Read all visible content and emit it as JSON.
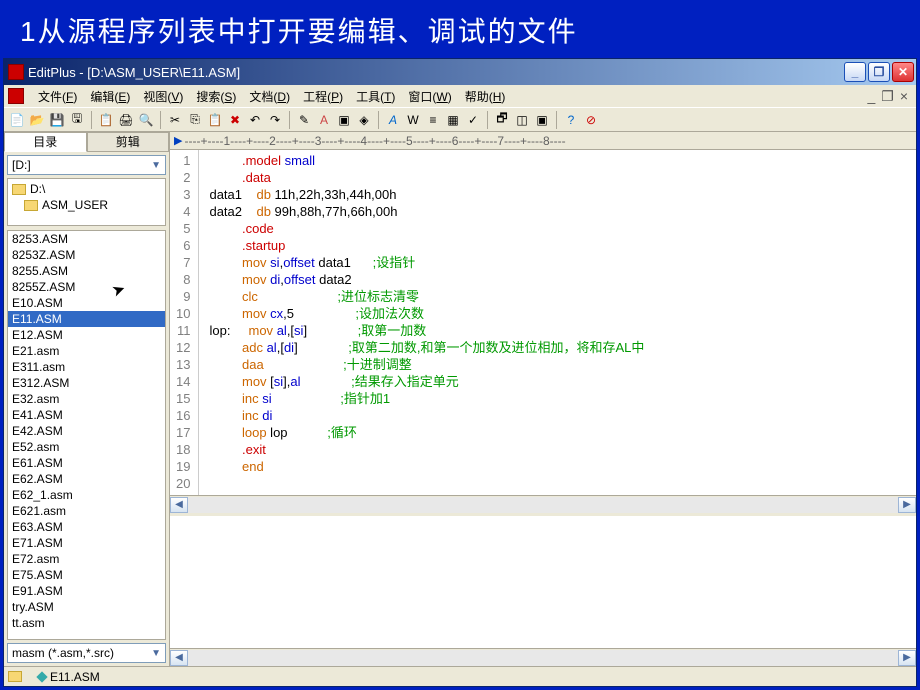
{
  "slide": {
    "title": "1从源程序列表中打开要编辑、调试的文件"
  },
  "titlebar": {
    "text": "EditPlus - [D:\\ASM_USER\\E11.ASM]"
  },
  "menu": {
    "items": [
      {
        "label": "文件",
        "accel": "F"
      },
      {
        "label": "编辑",
        "accel": "E"
      },
      {
        "label": "视图",
        "accel": "V"
      },
      {
        "label": "搜索",
        "accel": "S"
      },
      {
        "label": "文档",
        "accel": "D"
      },
      {
        "label": "工程",
        "accel": "P"
      },
      {
        "label": "工具",
        "accel": "T"
      },
      {
        "label": "窗口",
        "accel": "W"
      },
      {
        "label": "帮助",
        "accel": "H"
      }
    ]
  },
  "sidebar": {
    "tabs": {
      "dir": "目录",
      "clip": "剪辑"
    },
    "drive": "[D:]",
    "dirs": [
      "D:\\",
      "ASM_USER"
    ],
    "files": [
      "8253.ASM",
      "8253Z.ASM",
      "8255.ASM",
      "8255Z.ASM",
      "E10.ASM",
      "E11.ASM",
      "E12.ASM",
      "E21.asm",
      "E311.asm",
      "E312.ASM",
      "E32.asm",
      "E41.ASM",
      "E42.ASM",
      "E52.asm",
      "E61.ASM",
      "E62.ASM",
      "E62_1.asm",
      "E621.asm",
      "E63.ASM",
      "E71.ASM",
      "E72.asm",
      "E75.ASM",
      "E91.ASM",
      "try.ASM",
      "tt.asm"
    ],
    "selected_file": "E11.ASM",
    "filter": "masm (*.asm,*.src)"
  },
  "ruler": "----+----1----+----2----+----3----+----4----+----5----+----6----+----7----+----8----",
  "code_lines": [
    {
      "n": 1,
      "html": "         <span class='dir'>.model</span> <span class='kw'>small</span>"
    },
    {
      "n": 2,
      "html": "         <span class='dir'>.data</span>"
    },
    {
      "n": 3,
      "html": "<span class='lbl'>data1</span>    <span class='inst'>db</span> 11h,22h,33h,44h,00h"
    },
    {
      "n": 4,
      "html": "<span class='lbl'>data2</span>    <span class='inst'>db</span> 99h,88h,77h,66h,00h"
    },
    {
      "n": 5,
      "html": "         <span class='dir'>.code</span>"
    },
    {
      "n": 6,
      "html": "         <span class='dir'>.startup</span>"
    },
    {
      "n": 7,
      "html": "         <span class='inst'>mov</span> <span class='kw'>si</span>,<span class='kw'>offset</span> data1      <span class='cmt'>;设指针</span>"
    },
    {
      "n": 8,
      "html": "         <span class='inst'>mov</span> <span class='kw'>di</span>,<span class='kw'>offset</span> data2"
    },
    {
      "n": 9,
      "html": "         <span class='inst'>clc</span>                      <span class='cmt'>;进位标志清零</span>"
    },
    {
      "n": 10,
      "html": "         <span class='inst'>mov</span> <span class='kw'>cx</span>,5                 <span class='cmt'>;设加法次数</span>"
    },
    {
      "n": 11,
      "html": "<span class='lbl'>lop:</span>     <span class='inst'>mov</span> <span class='kw'>al</span>,[<span class='kw'>si</span>]              <span class='cmt'>;取第一加数</span>"
    },
    {
      "n": 12,
      "html": "         <span class='inst'>adc</span> <span class='kw'>al</span>,[<span class='kw'>di</span>]              <span class='cmt'>;取第二加数,和第一个加数及进位相加，将和存AL中</span>"
    },
    {
      "n": 13,
      "html": "         <span class='inst'>daa</span>                      <span class='cmt'>;十进制调整</span>"
    },
    {
      "n": 14,
      "html": "         <span class='inst'>mov</span> [<span class='kw'>si</span>],<span class='kw'>al</span>              <span class='cmt'>;结果存入指定单元</span>"
    },
    {
      "n": 15,
      "html": "         <span class='inst'>inc</span> <span class='kw'>si</span>                   <span class='cmt'>;指针加1</span>"
    },
    {
      "n": 16,
      "html": "         <span class='inst'>inc</span> <span class='kw'>di</span>"
    },
    {
      "n": 17,
      "html": "         <span class='inst'>loop</span> lop           <span class='cmt'>;循环</span>"
    },
    {
      "n": 18,
      "html": "         <span class='dir'>.exit</span>"
    },
    {
      "n": 19,
      "html": "         <span class='inst'>end</span>"
    },
    {
      "n": 20,
      "html": ""
    }
  ],
  "status": {
    "file": "E11.ASM"
  }
}
